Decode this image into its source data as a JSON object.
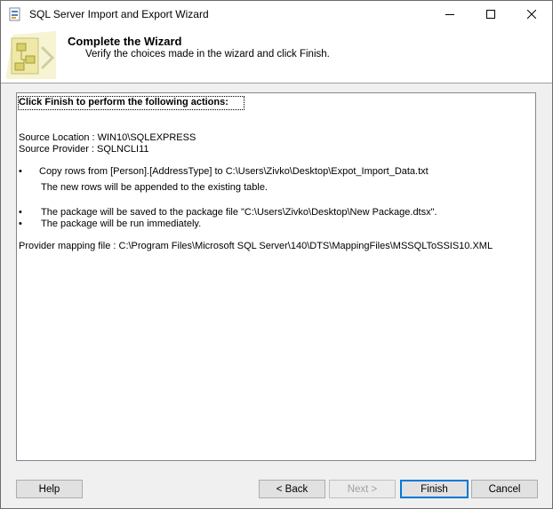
{
  "window": {
    "title": "SQL Server Import and Export Wizard"
  },
  "header": {
    "title": "Complete the Wizard",
    "subtitle": "Verify the choices made in the wizard and click Finish."
  },
  "summary": {
    "heading": "Click Finish to perform the following actions:",
    "source_location": "Source Location : WIN10\\SQLEXPRESS",
    "source_provider": "Source Provider : SQLNCLI11",
    "bullet_char": "•",
    "action1_line1": "Copy rows from [Person].[AddressType] to C:\\Users\\Zivko\\Desktop\\Expot_Import_Data.txt",
    "action1_line2": "The new rows will be appended to the existing table.",
    "action2_line1": "The package will be saved to the package file \"C:\\Users\\Zivko\\Desktop\\New Package.dtsx\".",
    "action2_line2": "The package will be run immediately.",
    "provider_mapping": "Provider mapping file : C:\\Program Files\\Microsoft SQL Server\\140\\DTS\\MappingFiles\\MSSQLToSSIS10.XML"
  },
  "buttons": {
    "help": "Help",
    "back": "< Back",
    "next": "Next >",
    "finish": "Finish",
    "cancel": "Cancel"
  },
  "colors": {
    "accent": "#0078d7"
  },
  "icons": [
    "app-icon",
    "minimize-icon",
    "maximize-icon",
    "close-icon",
    "wizard-icon"
  ]
}
